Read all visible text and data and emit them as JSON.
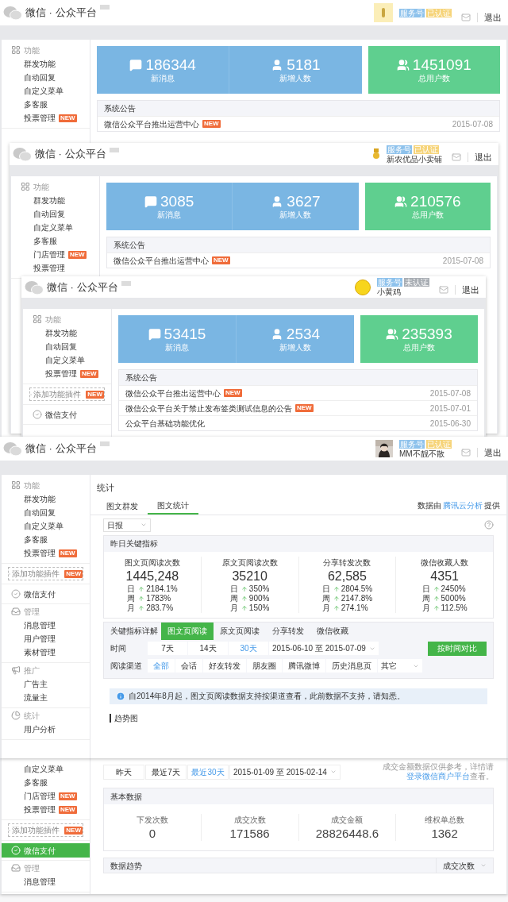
{
  "windows": [
    {
      "kind": "dashboard",
      "header": {
        "brand": "微信 · 公众平台",
        "avatar": {
          "kind": "square"
        },
        "badges": [
          {
            "text": "服务号",
            "color": "#8ec2ec"
          },
          {
            "text": "已认证",
            "color": "#f6d47a"
          }
        ],
        "logout": "退出"
      },
      "sidebar": [
        {
          "kind": "features",
          "title": "功能",
          "items": [
            {
              "label": "群发功能"
            },
            {
              "label": "自动回复"
            },
            {
              "label": "自定义菜单"
            },
            {
              "label": "多客服"
            },
            {
              "label": "投票管理",
              "badge": "NEW"
            }
          ]
        }
      ],
      "stats": [
        {
          "value": "186344",
          "label": "新消息",
          "color": "#7ab6e3"
        },
        {
          "value": "5181",
          "label": "新增人数",
          "color": "#7ab6e3"
        },
        {
          "value": "1451091",
          "label": "总用户数",
          "color": "#5fcf8f"
        }
      ],
      "notices": {
        "title": "系统公告",
        "rows": [
          {
            "title": "微信公众平台推出运营中心",
            "badge": "NEW",
            "date": "2015-07-08"
          }
        ]
      }
    },
    {
      "kind": "dashboard",
      "header": {
        "brand": "微信 · 公众平台",
        "avatar": {
          "kind": "emblem"
        },
        "badges": [
          {
            "text": "服务号",
            "color": "#8ec2ec"
          },
          {
            "text": "已认证",
            "color": "#f6d47a"
          }
        ],
        "username": "新农优品小卖铺",
        "logout": "退出"
      },
      "sidebar": [
        {
          "kind": "features",
          "title": "功能",
          "items": [
            {
              "label": "群发功能"
            },
            {
              "label": "自动回复"
            },
            {
              "label": "自定义菜单"
            },
            {
              "label": "多客服"
            },
            {
              "label": "门店管理",
              "badge": "NEW"
            },
            {
              "label": "投票管理"
            }
          ]
        }
      ],
      "stats": [
        {
          "value": "3085",
          "label": "新消息",
          "color": "#7ab6e3"
        },
        {
          "value": "3627",
          "label": "新增人数",
          "color": "#7ab6e3"
        },
        {
          "value": "210576",
          "label": "总用户数",
          "color": "#5fcf8f"
        }
      ],
      "notices": {
        "title": "系统公告",
        "rows": [
          {
            "title": "微信公众平台推出运营中心",
            "badge": "NEW",
            "date": "2015-07-08"
          }
        ]
      }
    },
    {
      "kind": "dashboard",
      "header": {
        "brand": "微信 · 公众平台",
        "avatar": {
          "kind": "round"
        },
        "badges": [
          {
            "text": "服务号",
            "color": "#8ec2ec"
          },
          {
            "text": "未认证",
            "color": "#a9aeb4"
          }
        ],
        "username": "小黄鸡",
        "logout": "退出"
      },
      "sidebar": [
        {
          "kind": "features",
          "title": "功能",
          "items": [
            {
              "label": "群发功能"
            },
            {
              "label": "自动回复"
            },
            {
              "label": "自定义菜单"
            },
            {
              "label": "投票管理",
              "badge": "NEW"
            }
          ]
        },
        {
          "kind": "plugin",
          "label": "添加功能插件",
          "badge": "NEW"
        },
        {
          "kind": "pay",
          "label": "微信支付",
          "selected": false
        }
      ],
      "stats": [
        {
          "value": "53415",
          "label": "新消息",
          "color": "#7ab6e3"
        },
        {
          "value": "2534",
          "label": "新增人数",
          "color": "#7ab6e3"
        },
        {
          "value": "235393",
          "label": "总用户数",
          "color": "#5fcf8f"
        }
      ],
      "notices": {
        "title": "系统公告",
        "rows": [
          {
            "title": "微信公众平台推出运营中心",
            "badge": "NEW",
            "date": "2015-07-08"
          },
          {
            "title": "微信公众平台关于禁止发布签类测试信息的公告",
            "badge": "NEW",
            "date": "2015-07-01"
          },
          {
            "title": "公众平台基础功能优化",
            "date": "2015-06-30"
          }
        ]
      }
    },
    {
      "kind": "stats",
      "header": {
        "brand": "微信 · 公众平台",
        "badges": [
          {
            "text": "服务号",
            "color": "#8ec2ec"
          },
          {
            "text": "已认证",
            "color": "#f6d47a"
          }
        ],
        "username": "MM不靓不散",
        "logout": "退出"
      },
      "sidebar": [
        {
          "kind": "features",
          "title": "功能",
          "items": [
            {
              "label": "群发功能"
            },
            {
              "label": "自动回复"
            },
            {
              "label": "自定义菜单"
            },
            {
              "label": "多客服"
            },
            {
              "label": "投票管理",
              "badge": "NEW"
            }
          ]
        },
        {
          "kind": "plugin",
          "label": "添加功能插件",
          "badge": "NEW"
        },
        {
          "kind": "pay",
          "label": "微信支付",
          "selected": false
        },
        {
          "kind": "manage",
          "title": "管理",
          "items": [
            {
              "label": "消息管理"
            },
            {
              "label": "用户管理"
            },
            {
              "label": "素材管理"
            }
          ]
        },
        {
          "kind": "promote",
          "title": "推广",
          "items": [
            {
              "label": "广告主"
            },
            {
              "label": "流量主"
            }
          ]
        },
        {
          "kind": "analytics",
          "title": "统计",
          "items": [
            {
              "label": "用户分析"
            }
          ]
        }
      ],
      "page": {
        "title": "统计",
        "tabs": [
          {
            "label": "图文群发",
            "selected": false
          },
          {
            "label": "图文统计",
            "selected": true
          }
        ],
        "source": {
          "prefix": "数据由",
          "link": "腾讯云分析",
          "suffix": "提供"
        },
        "report_select": "日报",
        "summary": {
          "title": "昨日关键指标",
          "metrics": [
            {
              "label": "图文页阅读次数",
              "value": "1445,248",
              "changes": [
                {
                  "period": "日",
                  "value": "2184.1%"
                },
                {
                  "period": "周",
                  "value": "1783%"
                },
                {
                  "period": "月",
                  "value": "283.7%"
                }
              ]
            },
            {
              "label": "原文页阅读次数",
              "value": "35210",
              "changes": [
                {
                  "period": "日",
                  "value": "350%"
                },
                {
                  "period": "周",
                  "value": "900%"
                },
                {
                  "period": "月",
                  "value": "150%"
                }
              ]
            },
            {
              "label": "分享转发次数",
              "value": "62,585",
              "changes": [
                {
                  "period": "日",
                  "value": "2804.5%"
                },
                {
                  "period": "周",
                  "value": "2147.8%"
                },
                {
                  "period": "月",
                  "value": "274.1%"
                }
              ]
            },
            {
              "label": "微信收藏人数",
              "value": "4351",
              "changes": [
                {
                  "period": "日",
                  "value": "2450%"
                },
                {
                  "period": "周",
                  "value": "5000%"
                },
                {
                  "period": "月",
                  "value": "112.5%"
                }
              ]
            }
          ]
        },
        "detail": {
          "label": "关键指标详解",
          "tabs": [
            {
              "label": "图文页阅读",
              "selected": true
            },
            {
              "label": "原文页阅读",
              "selected": false
            },
            {
              "label": "分享转发",
              "selected": false
            },
            {
              "label": "微信收藏",
              "selected": false
            }
          ],
          "time": {
            "label": "时间",
            "options": [
              {
                "label": "7天",
                "selected": false
              },
              {
                "label": "14天",
                "selected": false
              },
              {
                "label": "30天",
                "selected": true
              }
            ],
            "range": "2015-06-10 至 2015-07-09",
            "compare": "按时间对比"
          },
          "channel": {
            "label": "阅读渠道",
            "options": [
              {
                "label": "全部",
                "selected": true
              },
              {
                "label": "会话",
                "selected": false
              },
              {
                "label": "好友转发",
                "selected": false
              },
              {
                "label": "朋友圈",
                "selected": false
              },
              {
                "label": "腾讯微博",
                "selected": false
              },
              {
                "label": "历史消息页",
                "selected": false
              }
            ],
            "other": "其它"
          }
        },
        "info": "自2014年8月起，图文页阅读数据支持按渠道查看，此前数据不支持，请知悉。",
        "trend_title": "趋势图"
      }
    },
    {
      "kind": "pay",
      "sidebar": [
        {
          "kind": "list",
          "items": [
            {
              "label": "自定义菜单"
            },
            {
              "label": "多客服"
            },
            {
              "label": "门店管理",
              "badge": "NEW"
            },
            {
              "label": "投票管理",
              "badge": "NEW"
            }
          ]
        },
        {
          "kind": "plugin",
          "label": "添加功能插件",
          "badge": "NEW"
        },
        {
          "kind": "pay",
          "label": "微信支付",
          "selected": true
        },
        {
          "kind": "manage",
          "title": "管理",
          "items": [
            {
              "label": "消息管理"
            }
          ]
        }
      ],
      "page": {
        "periods": [
          {
            "label": "昨天",
            "selected": false
          },
          {
            "label": "最近7天",
            "selected": false
          },
          {
            "label": "最近30天",
            "selected": true
          }
        ],
        "range": "2015-01-09 至 2015-02-14",
        "note": {
          "text": "成交金额数据仅供参考，详情请",
          "link": "登录微信商户平台",
          "suffix": "查看。"
        },
        "basic": {
          "title": "基本数据",
          "metrics": [
            {
              "label": "下发次数",
              "value": "0"
            },
            {
              "label": "成交次数",
              "value": "171586"
            },
            {
              "label": "成交金额",
              "value": "28826448.6"
            },
            {
              "label": "维权单总数",
              "value": "1362"
            }
          ]
        },
        "trend": {
          "title": "数据趋势",
          "select": "成交次数"
        }
      }
    }
  ]
}
